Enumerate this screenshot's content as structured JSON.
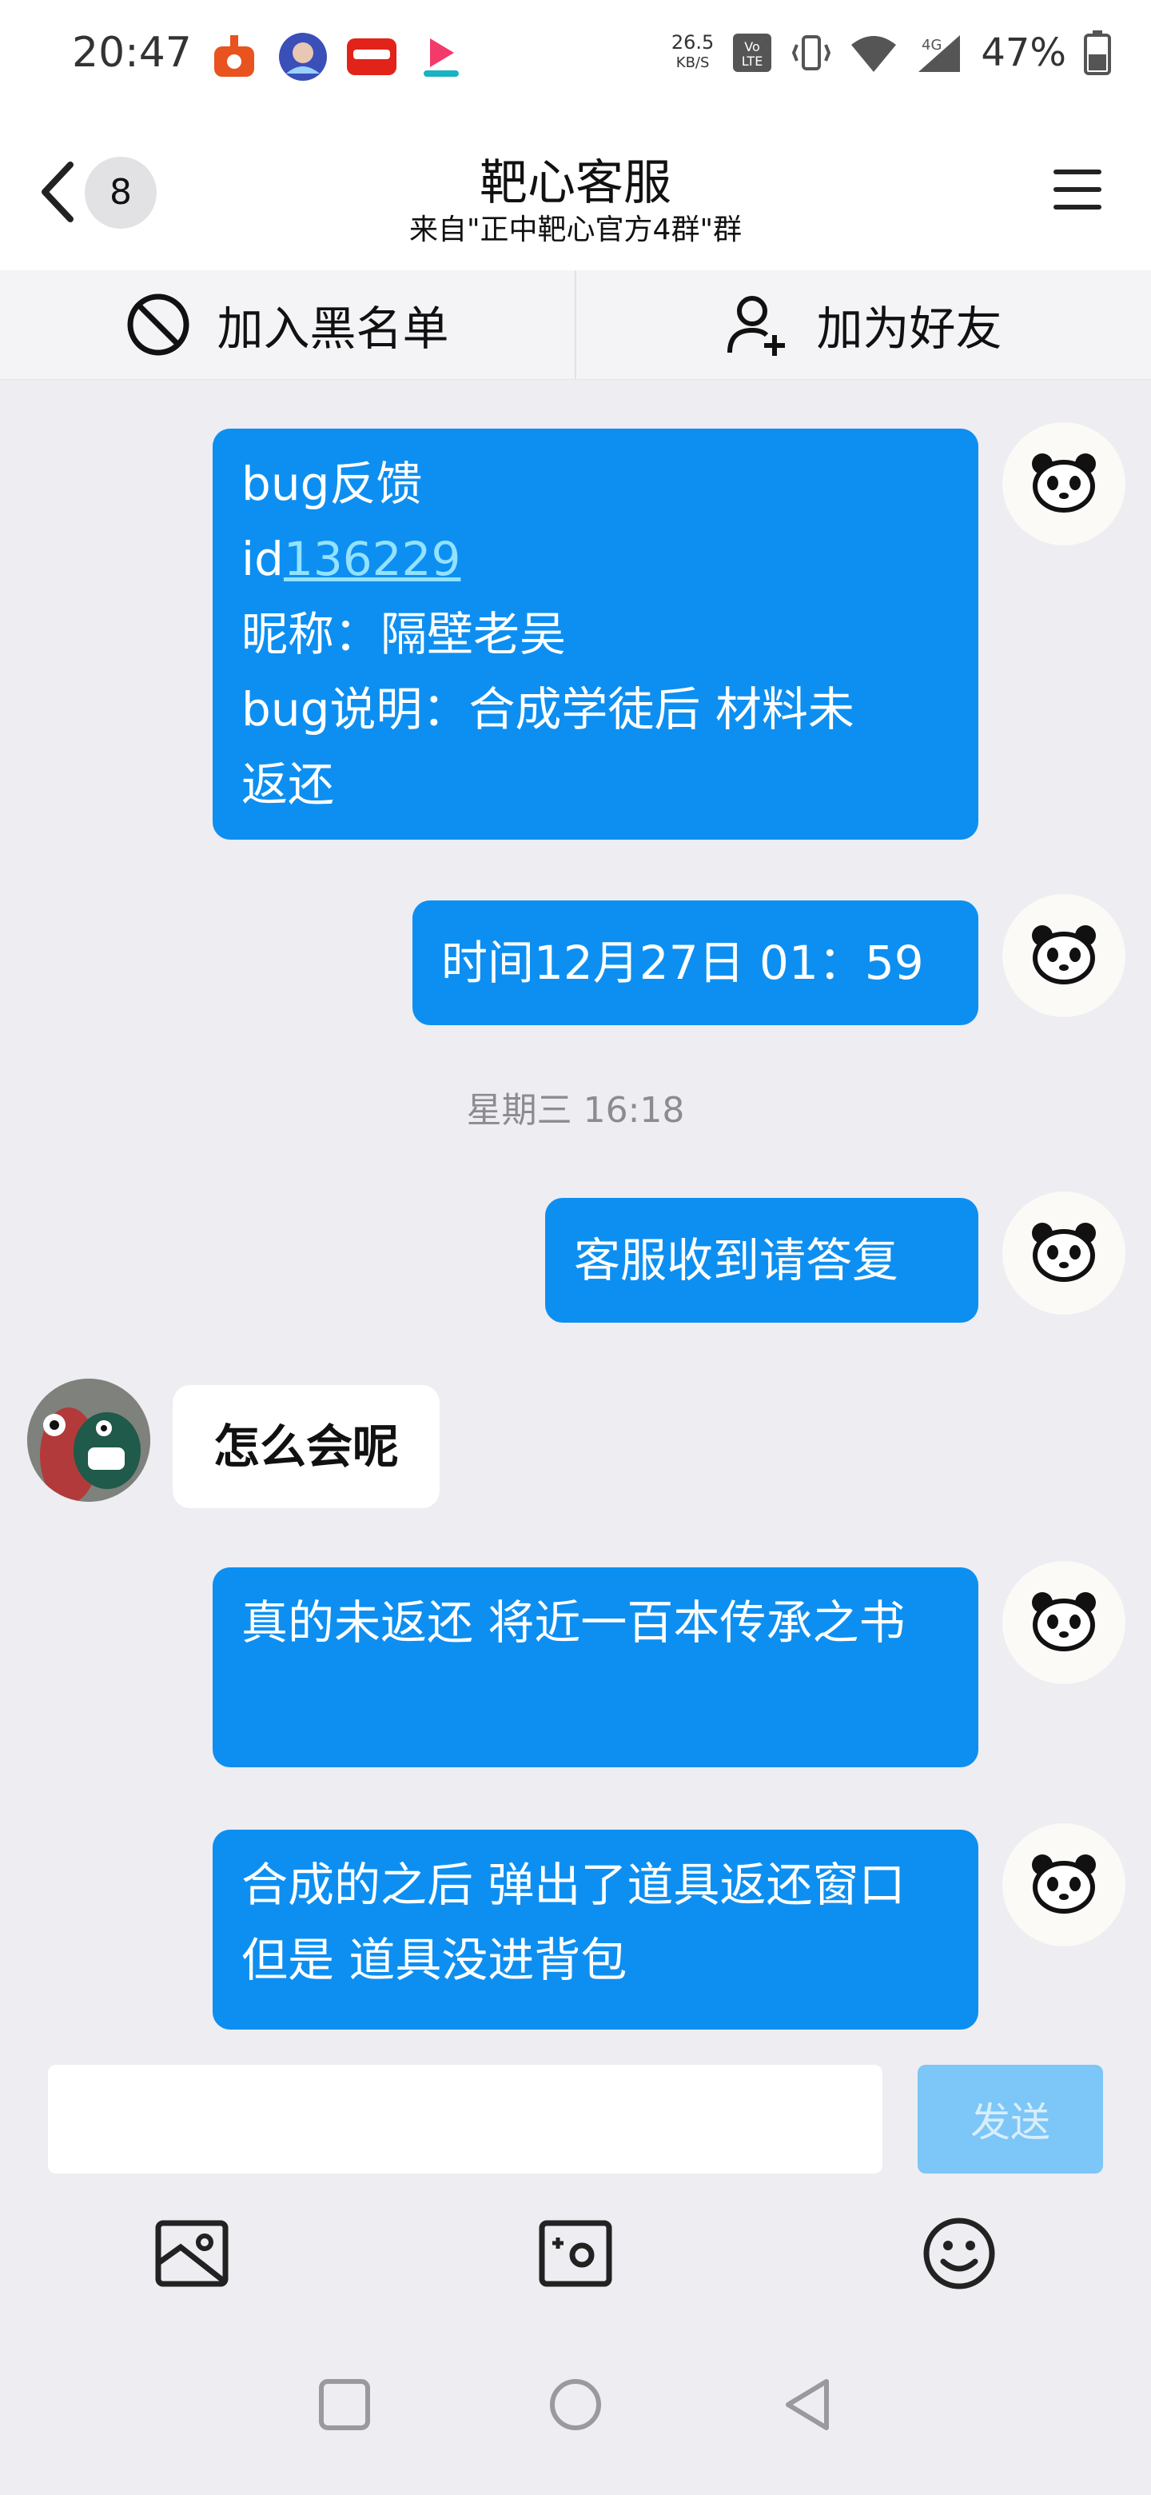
{
  "status_bar": {
    "time": "20:47",
    "net_speed_value": "26.5",
    "net_speed_unit": "KB/S",
    "volte": "VoLTE",
    "network": "4G",
    "battery": "47%"
  },
  "header": {
    "unread_count": "8",
    "title": "靶心客服",
    "subtitle": "来自\"正中靶心官方4群\"群"
  },
  "actions": {
    "blacklist_label": "加入黑名单",
    "add_friend_label": "加为好友"
  },
  "messages": {
    "m1": {
      "line1": "bug反馈",
      "line2_prefix": "id",
      "line2_link": "136229",
      "line3": "昵称：隔壁老吴",
      "line4": "bug说明：合成学徒后 材料未",
      "line5": "返还"
    },
    "m2": "时间12月27日 01：59",
    "time_divider": "星期三 16:18",
    "m3": "客服收到请答复",
    "m4_sticker_text": "怎么会呢",
    "m5": "真的未返还 将近一百本传承之书",
    "m6": "合成的之后 弹出了道具返还窗口 但是 道具没进背包"
  },
  "input": {
    "placeholder": "",
    "send_label": "发送"
  },
  "icons": {
    "back": "chevron-left-icon",
    "menu": "hamburger-menu-icon",
    "blacklist": "block-icon",
    "add_friend": "add-user-icon",
    "gallery": "image-icon",
    "camera": "camera-icon",
    "emoji": "emoji-icon",
    "self_avatar": "panda-icon",
    "nav_recent": "square-icon",
    "nav_home": "circle-icon",
    "nav_back": "triangle-back-icon"
  },
  "colors": {
    "bubble_out": "#0d8ff1",
    "link": "#93e2ff",
    "send_disabled": "#7cc6f8"
  }
}
